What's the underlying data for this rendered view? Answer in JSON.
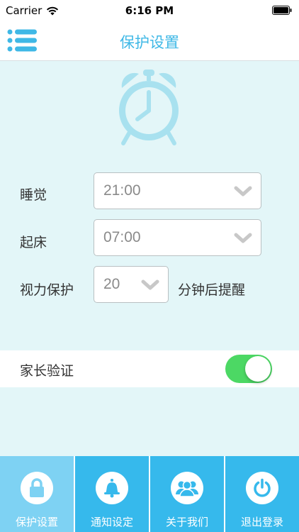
{
  "status_bar": {
    "carrier": "Carrier",
    "time": "6:16 PM"
  },
  "nav": {
    "title": "保护设置"
  },
  "form": {
    "sleep": {
      "label": "睡觉",
      "value": "21:00"
    },
    "wake": {
      "label": "起床",
      "value": "07:00"
    },
    "eye": {
      "label": "视力保护",
      "value": "20",
      "suffix": "分钟后提醒"
    }
  },
  "parent_verify": {
    "label": "家长验证",
    "enabled": true
  },
  "tabs": [
    {
      "label": "保护设置",
      "icon": "lock-icon",
      "active": true
    },
    {
      "label": "通知设定",
      "icon": "bell-icon",
      "active": false
    },
    {
      "label": "关于我们",
      "icon": "users-icon",
      "active": false
    },
    {
      "label": "退出登录",
      "icon": "power-icon",
      "active": false
    }
  ],
  "colors": {
    "accent": "#3fb8e6",
    "tab_bg": "#36b9ec",
    "tab_active": "#7ed2f3",
    "page_bg": "#e3f6f8",
    "toggle_on": "#4cd864",
    "clock": "#a8e1ef"
  }
}
